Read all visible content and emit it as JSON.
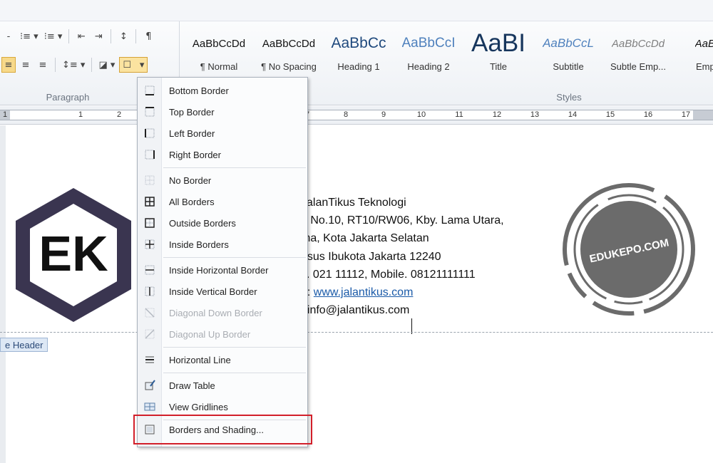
{
  "ribbon": {
    "paragraph_label": "Paragraph",
    "styles_label": "Styles",
    "styles": [
      {
        "sample": "AaBbCcDd",
        "name": "¶ Normal"
      },
      {
        "sample": "AaBbCcDd",
        "name": "¶ No Spacing"
      },
      {
        "sample": "AaBbCc",
        "name": "Heading 1"
      },
      {
        "sample": "AaBbCcI",
        "name": "Heading 2"
      },
      {
        "sample": "AaBI",
        "name": "Title"
      },
      {
        "sample": "AaBbCcL",
        "name": "Subtitle"
      },
      {
        "sample": "AaBbCcDd",
        "name": "Subtle Emp..."
      },
      {
        "sample": "AaBb",
        "name": "Emph"
      }
    ]
  },
  "ruler": {
    "numbers": [
      "1",
      "1",
      "2",
      "7",
      "8",
      "9",
      "10",
      "11",
      "12",
      "13",
      "14",
      "15",
      "16",
      "17"
    ]
  },
  "document": {
    "address_lines": [
      {
        "prefix": "",
        "text": "JalanTikus Teknologi"
      },
      {
        "prefix": "",
        "text": "a No.10, RT10/RW06, Kby. Lama Utara,"
      },
      {
        "prefix": "",
        "text": "ma, Kota Jakarta Selatan"
      },
      {
        "prefix": "",
        "text": "usus Ibukota Jakarta 12240"
      },
      {
        "prefix": "",
        "text": "x. 021 11112, Mobile. 08121111111"
      },
      {
        "prefix": "e: ",
        "link": "www.jalantikus.com"
      },
      {
        "prefix": ": ",
        "text": "info@jalantikus.com"
      }
    ],
    "header_tag": "e Header",
    "logo_left_text": "EK",
    "logo_right_text": "EDUKEPO.COM"
  },
  "border_menu": {
    "items": [
      {
        "label": "Bottom Border",
        "icon": "bottom-border-icon",
        "disabled": false
      },
      {
        "label": "Top Border",
        "icon": "top-border-icon",
        "disabled": false
      },
      {
        "label": "Left Border",
        "icon": "left-border-icon",
        "disabled": false
      },
      {
        "label": "Right Border",
        "icon": "right-border-icon",
        "disabled": false
      },
      {
        "label": "No Border",
        "icon": "no-border-icon",
        "disabled": false
      },
      {
        "label": "All Borders",
        "icon": "all-borders-icon",
        "disabled": false
      },
      {
        "label": "Outside Borders",
        "icon": "outside-borders-icon",
        "disabled": false
      },
      {
        "label": "Inside Borders",
        "icon": "inside-borders-icon",
        "disabled": false
      },
      {
        "label": "Inside Horizontal Border",
        "icon": "inside-horizontal-border-icon",
        "disabled": false
      },
      {
        "label": "Inside Vertical Border",
        "icon": "inside-vertical-border-icon",
        "disabled": false
      },
      {
        "label": "Diagonal Down Border",
        "icon": "diagonal-down-border-icon",
        "disabled": true
      },
      {
        "label": "Diagonal Up Border",
        "icon": "diagonal-up-border-icon",
        "disabled": true
      },
      {
        "label": "Horizontal Line",
        "icon": "horizontal-line-icon",
        "disabled": false
      },
      {
        "label": "Draw Table",
        "icon": "draw-table-icon",
        "disabled": false
      },
      {
        "label": "View Gridlines",
        "icon": "view-gridlines-icon",
        "disabled": false
      },
      {
        "label": "Borders and Shading...",
        "icon": "borders-shading-icon",
        "disabled": false
      }
    ]
  },
  "colors": {
    "highlight": "#d21f2a",
    "active_button": "#f7d98a",
    "link": "#1a5aa8",
    "logo_dark": "#3a3550",
    "logo_gray": "#6b6b6b"
  }
}
